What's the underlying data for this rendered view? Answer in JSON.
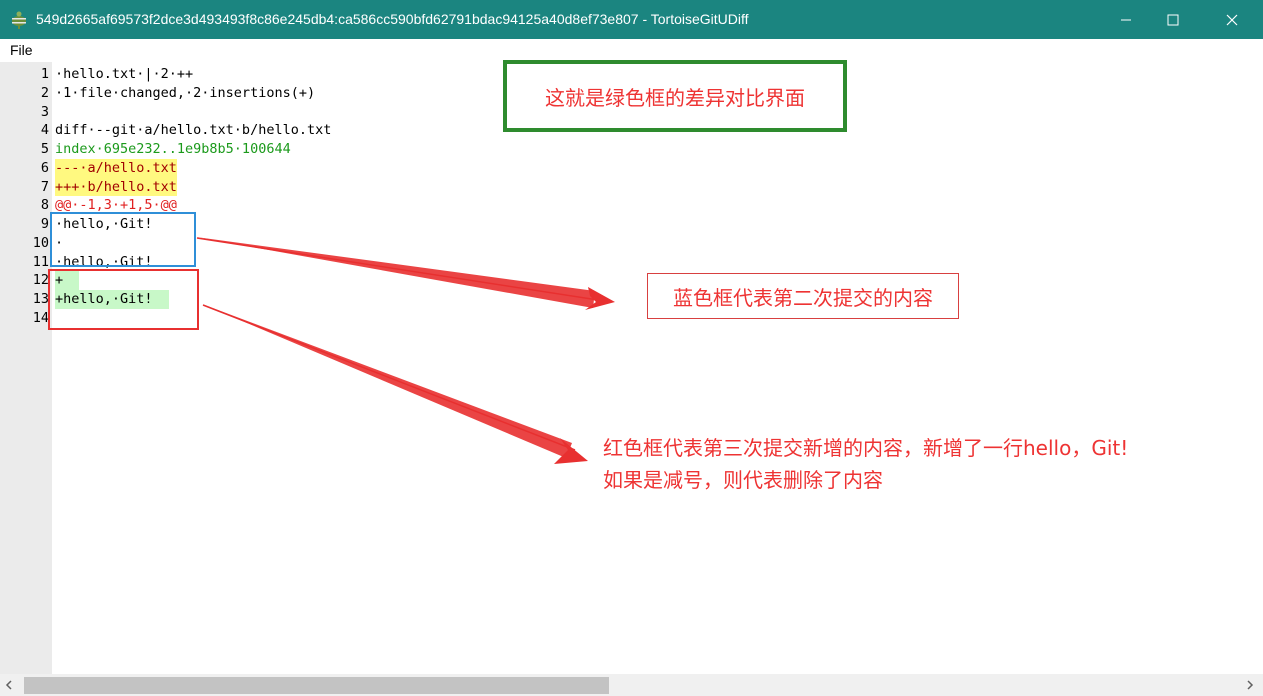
{
  "window": {
    "title": "549d2665af69573f2dce3d493493f8c86e245db4:ca586cc590bfd62791bdac94125a40d8ef73e807 - TortoiseGitUDiff",
    "app_icon": "tortoisegit-icon",
    "accent_color": "#1b8580"
  },
  "menu": {
    "file_label": "File"
  },
  "editor": {
    "line_numbers": [
      "1",
      "2",
      "3",
      "4",
      "5",
      "6",
      "7",
      "8",
      "9",
      "10",
      "11",
      "12",
      "13",
      "14"
    ],
    "lines": [
      {
        "text": "·hello.txt·|·2·++",
        "style": "plain"
      },
      {
        "text": "·1·file·changed,·2·insertions(+)",
        "style": "plain"
      },
      {
        "text": "",
        "style": "plain"
      },
      {
        "text": "diff·--git·a/hello.txt·b/hello.txt",
        "style": "plain"
      },
      {
        "text": "index·695e232..1e9b8b5·100644",
        "style": "index"
      },
      {
        "text": "---·a/hello.txt",
        "style": "hdr"
      },
      {
        "text": "+++·b/hello.txt",
        "style": "hdr"
      },
      {
        "text": "@@·-1,3·+1,5·@@",
        "style": "hunk"
      },
      {
        "text": "·hello,·Git!",
        "style": "plain"
      },
      {
        "text": "·",
        "style": "plain"
      },
      {
        "text": "·hello,·Git!",
        "style": "plain"
      },
      {
        "text": "+  ",
        "style": "add"
      },
      {
        "text": "+hello,·Git!  ",
        "style": "add"
      },
      {
        "text": "",
        "style": "plain"
      }
    ]
  },
  "annotations": {
    "green_box_text": "这就是绿色框的差异对比界面",
    "blue_label": "蓝色框代表第二次提交的内容",
    "red_label_line1": "红色框代表第三次提交新增的内容，新增了一行hello，Git!",
    "red_label_line2": "如果是减号，则代表删除了内容",
    "green_color": "#2e8b2e",
    "blue_color": "#2f8fd8",
    "red_color": "#e83030"
  }
}
